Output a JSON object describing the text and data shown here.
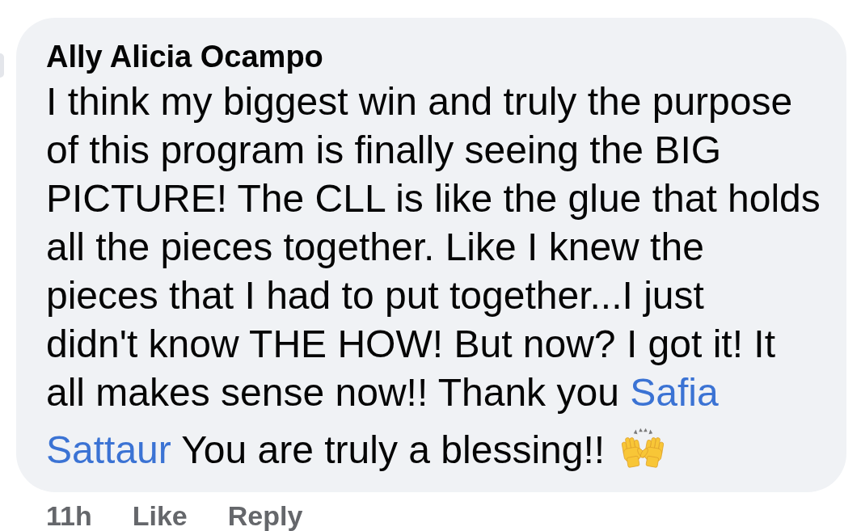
{
  "comment": {
    "author": "Ally Alicia Ocampo",
    "body": [
      {
        "kind": "text",
        "text": "I think my biggest win and truly the purpose\nof this program is finally seeing the BIG\nPICTURE! The CLL is like the glue that holds\nall the pieces together. Like I knew the\npieces that I had to put together...I just\ndidn't know THE HOW! But now? I got it! It\nall makes sense now!! Thank you"
      },
      {
        "kind": "mention",
        "text": "Safia Sattaur"
      },
      {
        "kind": "text",
        "text": "You are truly a blessing!!"
      }
    ],
    "time": "11h",
    "actions": [
      "Like",
      "Reply"
    ]
  }
}
